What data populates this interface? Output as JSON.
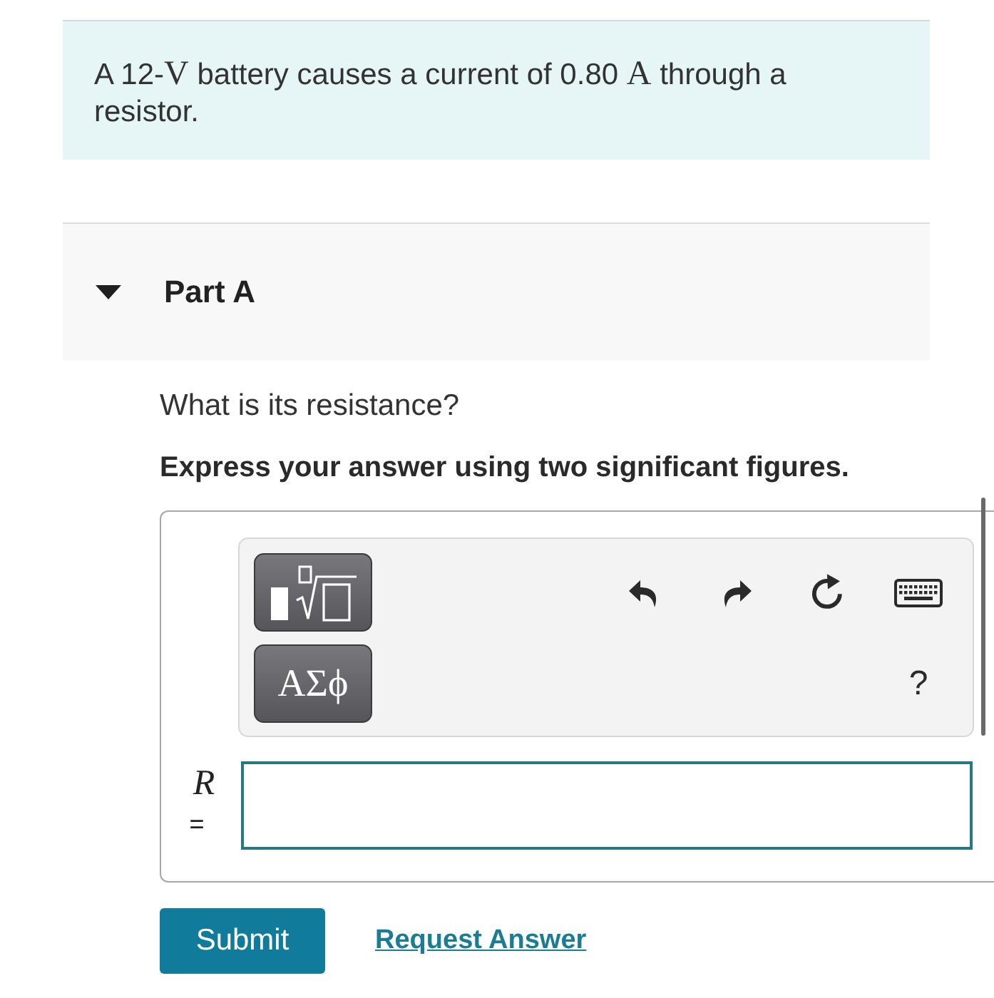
{
  "problem": {
    "parts": [
      {
        "kind": "text",
        "text": "A 12-"
      },
      {
        "kind": "math",
        "text": "V"
      },
      {
        "kind": "text",
        "text": " battery causes a current of 0.80 "
      },
      {
        "kind": "math",
        "text": "A"
      },
      {
        "kind": "text",
        "text": " through a resistor."
      }
    ]
  },
  "part": {
    "title": "Part A",
    "expanded": true,
    "question": "What is its resistance?",
    "instruction": "Express your answer using two significant figures.",
    "toolbar": {
      "symbols_label": "ΑΣϕ",
      "help_label": "?"
    },
    "answer": {
      "variable": "R",
      "relation": "="
    },
    "submit": "Submit",
    "request_answer": "Request Answer"
  }
}
